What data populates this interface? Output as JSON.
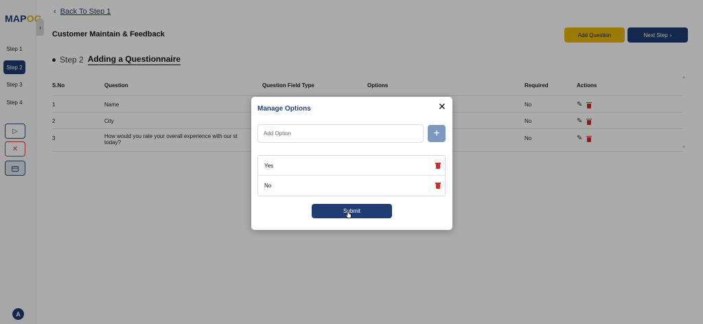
{
  "sidebar": {
    "logo_map": "MAP",
    "logo_og": "OG",
    "steps": [
      "Step 1",
      "Step 2",
      "Step 3",
      "Step 4"
    ],
    "active_step": "Step 2",
    "avatar_initial": "A"
  },
  "header": {
    "back_label": "Back To Step 1",
    "title": "Customer Maintain & Feedback",
    "add_question_label": "Add Question",
    "next_step_label": "Next Step"
  },
  "step": {
    "label": "Step 2",
    "name": "Adding a Questionnaire"
  },
  "table": {
    "headers": [
      "S.No",
      "Question",
      "Question Field Type",
      "Options",
      "Required",
      "Actions"
    ],
    "rows": [
      {
        "sno": "1",
        "question": "Name",
        "required": "No"
      },
      {
        "sno": "2",
        "question": "City",
        "required": "No"
      },
      {
        "sno": "3",
        "question": "How would you rate your overall experience with our st today?",
        "required": "No"
      }
    ]
  },
  "modal": {
    "title": "Manage Options",
    "close_symbol": "✕",
    "input_placeholder": "Add Option",
    "add_symbol": "+",
    "options": [
      "Yes",
      "No"
    ],
    "submit_label": "Submit"
  },
  "colors": {
    "primary": "#1f3d73",
    "accent": "#e8b80a",
    "danger": "#d42a2a",
    "add_button": "#7d98c0"
  }
}
